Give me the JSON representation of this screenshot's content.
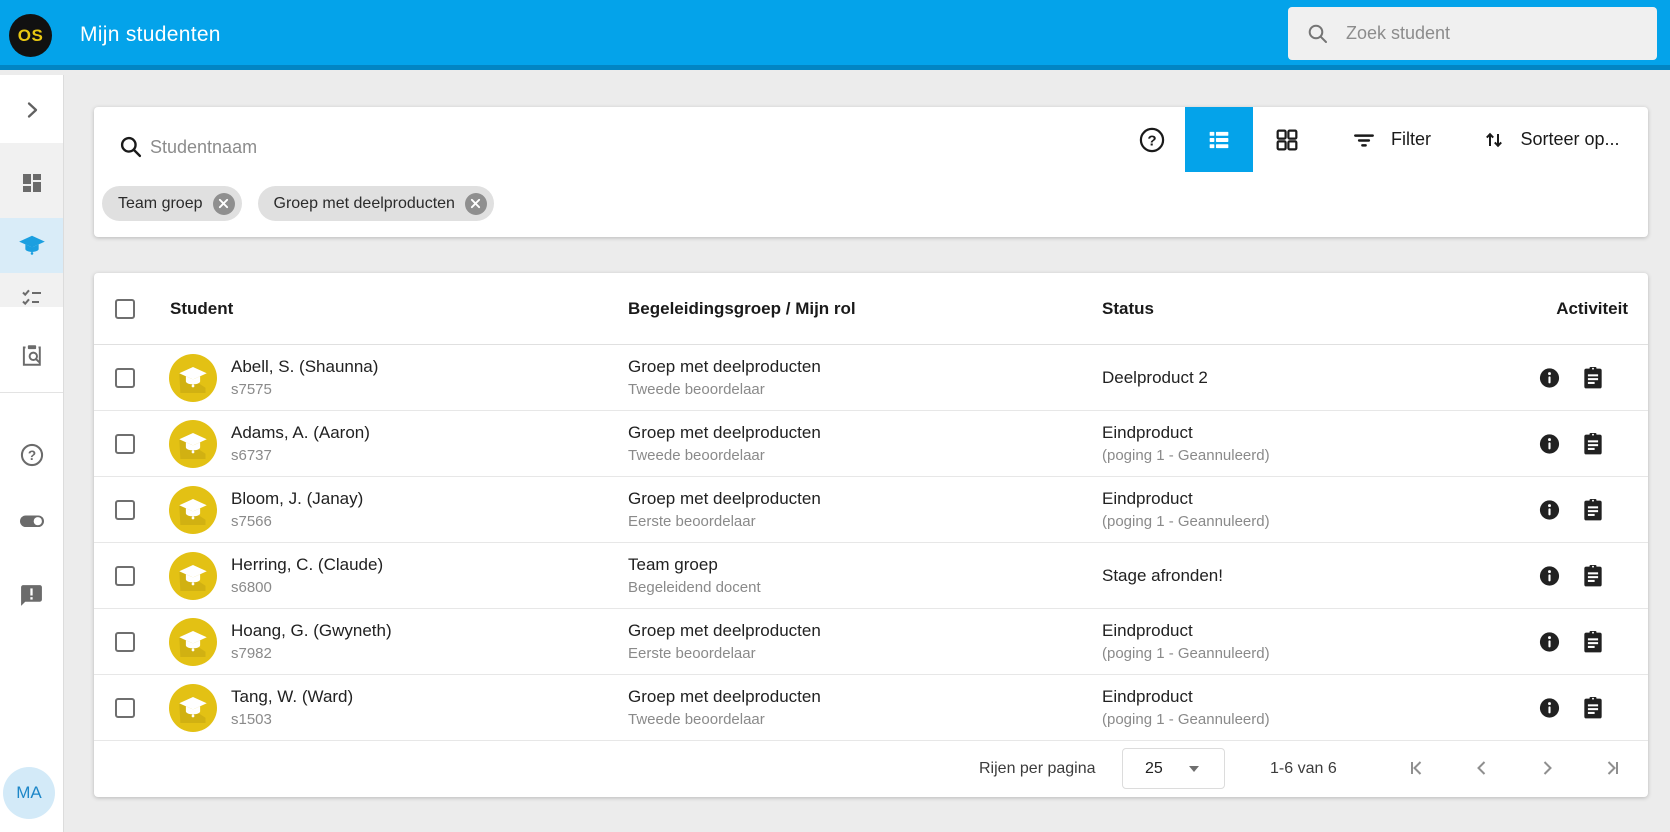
{
  "topbar": {
    "logo": "OS",
    "title": "Mijn studenten",
    "search_placeholder": "Zoek student"
  },
  "sidebar": {
    "items": [
      {
        "icon": "chevron-right-icon"
      },
      {
        "icon": "dashboard-icon"
      },
      {
        "icon": "graduation-cap-icon",
        "active": true
      },
      {
        "icon": "checklist-icon"
      },
      {
        "icon": "clipboard-search-icon"
      },
      {
        "icon": "help-icon"
      },
      {
        "icon": "toggle-icon"
      },
      {
        "icon": "feedback-icon"
      }
    ],
    "avatar": "MA"
  },
  "filter_card": {
    "search_placeholder": "Studentnaam",
    "chips": [
      "Team groep",
      "Groep met deelproducten"
    ],
    "view_icons": [
      "list-view-icon",
      "grid-view-icon"
    ],
    "active_view": "list",
    "filter_label": "Filter",
    "sort_label": "Sorteer op..."
  },
  "table": {
    "columns": [
      "Student",
      "Begeleidingsgroep / Mijn rol",
      "Status",
      "Activiteit"
    ],
    "rows": [
      {
        "name": "Abell, S. (Shaunna)",
        "sid": "s7575",
        "group": "Groep met deelproducten",
        "role": "Tweede beoordelaar",
        "status": "Deelproduct 2",
        "status_sub": ""
      },
      {
        "name": "Adams, A. (Aaron)",
        "sid": "s6737",
        "group": "Groep met deelproducten",
        "role": "Tweede beoordelaar",
        "status": "Eindproduct",
        "status_sub": "(poging 1 - Geannuleerd)"
      },
      {
        "name": "Bloom, J. (Janay)",
        "sid": "s7566",
        "group": "Groep met deelproducten",
        "role": "Eerste beoordelaar",
        "status": "Eindproduct",
        "status_sub": "(poging 1 - Geannuleerd)"
      },
      {
        "name": "Herring, C. (Claude)",
        "sid": "s6800",
        "group": "Team groep",
        "role": "Begeleidend docent",
        "status": "Stage afronden!",
        "status_sub": ""
      },
      {
        "name": "Hoang, G. (Gwyneth)",
        "sid": "s7982",
        "group": "Groep met deelproducten",
        "role": "Eerste beoordelaar",
        "status": "Eindproduct",
        "status_sub": "(poging 1 - Geannuleerd)"
      },
      {
        "name": "Tang, W. (Ward)",
        "sid": "s1503",
        "group": "Groep met deelproducten",
        "role": "Tweede beoordelaar",
        "status": "Eindproduct",
        "status_sub": "(poging 1 - Geannuleerd)"
      }
    ]
  },
  "pagination": {
    "rows_per_page_label": "Rijen per pagina",
    "rows_per_page": "25",
    "range": "1-6 van 6",
    "icons": [
      "first-page-icon",
      "previous-page-icon",
      "next-page-icon",
      "last-page-icon"
    ]
  },
  "colors": {
    "topbar_blue": "#04a3ea",
    "topbar_shadow": "#0285c3",
    "active_item_bg": "#d9ecf8",
    "student_avatar_yellow": "#e3c114",
    "logo_yellow": "#e8c812",
    "chip_bg": "#e0e0e0",
    "page_bg": "#ececec"
  }
}
